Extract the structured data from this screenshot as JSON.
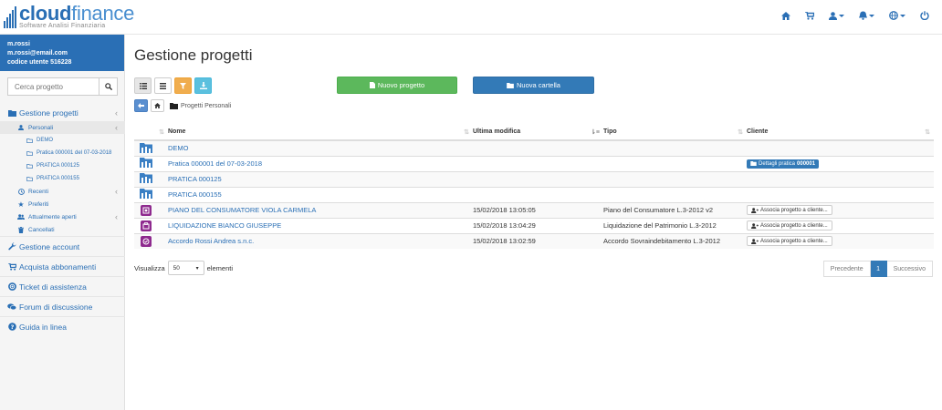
{
  "brand": {
    "name_bold": "cloud",
    "name_light": "finance",
    "subtitle": "Software Analisi Finanziaria"
  },
  "topnav": {
    "icons": [
      "home-icon",
      "cart-icon",
      "user-icon",
      "bell-icon",
      "globe-icon",
      "power-icon"
    ]
  },
  "user": {
    "username": "m.rossi",
    "email": "m.rossi@email.com",
    "code": "codice utente 516228"
  },
  "sidebar": {
    "search_placeholder": "Cerca progetto",
    "gestione_progetti": "Gestione progetti",
    "personali": "Personali",
    "folders": [
      "DEMO",
      "Pratica 000001 del 07-03-2018",
      "PRATICA 000125",
      "PRATICA 000155"
    ],
    "recenti": "Recenti",
    "preferiti": "Preferiti",
    "aperti": "Attualmente aperti",
    "cancellati": "Cancellati",
    "gestione_account": "Gestione account",
    "abbonamenti": "Acquista abbonamenti",
    "ticket": "Ticket di assistenza",
    "forum": "Forum di discussione",
    "guida": "Guida in linea"
  },
  "main": {
    "title": "Gestione progetti",
    "new_project": "Nuovo progetto",
    "new_folder": "Nuova cartella",
    "breadcrumb": "Progetti Personali"
  },
  "table": {
    "headers": {
      "nome": "Nome",
      "modifica": "Ultima modifica",
      "tipo": "Tipo",
      "cliente": "Cliente"
    },
    "folder_rows": [
      {
        "name": "DEMO"
      },
      {
        "name": "Pratica 000001 del 07-03-2018",
        "badge_label": "Dettagli pratica",
        "badge_num": "000001"
      },
      {
        "name": "PRATICA 000125"
      },
      {
        "name": "PRATICA 000155"
      }
    ],
    "project_rows": [
      {
        "name": "PIANO DEL CONSUMATORE VIOLA CARMELA",
        "date": "15/02/2018 13:05:05",
        "type": "Piano del Consumatore L.3-2012 v2",
        "action": "Associa progetto a cliente..."
      },
      {
        "name": "LIQUIDAZIONE BIANCO GIUSEPPE",
        "date": "15/02/2018 13:04:29",
        "type": "Liquidazione del Patrimonio L.3-2012",
        "action": "Associa progetto a cliente..."
      },
      {
        "name": "Accordo Rossi Andrea s.n.c.",
        "date": "15/02/2018 13:02:59",
        "type": "Accordo Sovraindebitamento L.3-2012",
        "action": "Associa progetto a cliente..."
      }
    ]
  },
  "footer": {
    "show_label": "Visualizza",
    "page_size": "50",
    "elements_label": "elementi",
    "prev": "Precedente",
    "page": "1",
    "next": "Successivo"
  },
  "colors": {
    "primary": "#2a6fb5",
    "green": "#5cb85c",
    "orange": "#f0ad4e",
    "cyan": "#5bc0de",
    "project_icon": "#8e2a8e"
  }
}
